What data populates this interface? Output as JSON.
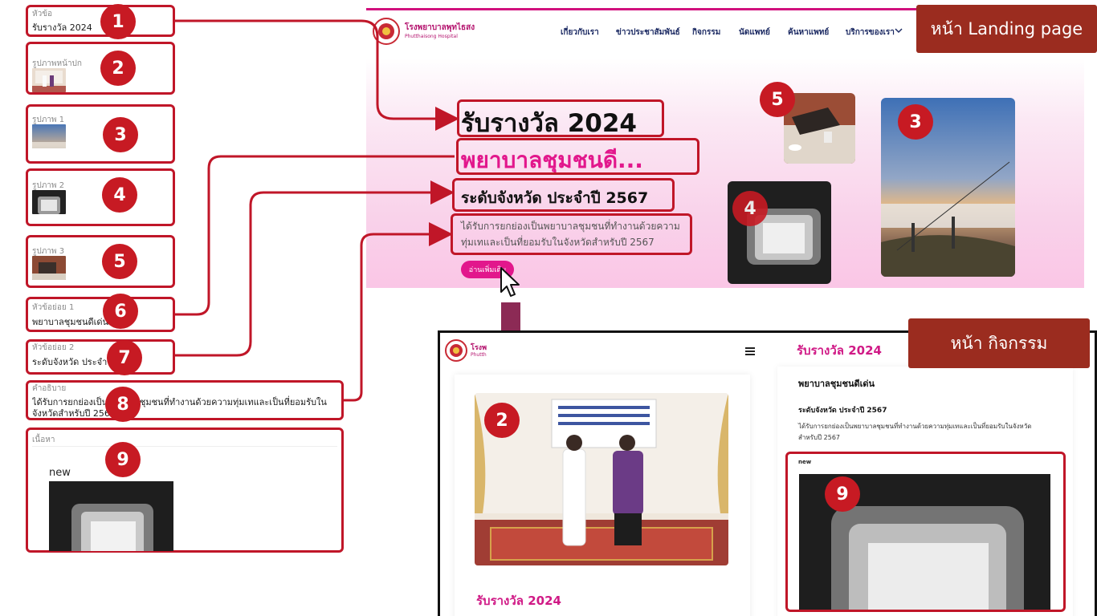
{
  "cms": {
    "fields": [
      {
        "label": "หัวข้อ",
        "value": "รับรางวัล 2024",
        "badge": "1"
      },
      {
        "label": "รูปภาพหน้าปก",
        "badge": "2"
      },
      {
        "label": "รูปภาพ 1",
        "badge": "3"
      },
      {
        "label": "รูปภาพ 2",
        "badge": "4"
      },
      {
        "label": "รูปภาพ 3",
        "badge": "5"
      },
      {
        "label": "หัวข้อย่อย 1",
        "value": "พยาบาลชุมชนดีเด่น",
        "badge": "6"
      },
      {
        "label": "หัวข้อย่อย 2",
        "value": "ระดับจังหวัด ประจำปี",
        "badge": "7"
      },
      {
        "label": "คำอธิบาย",
        "value_line1": "ได้รับการยกย่องเป็นพยาบาลชุมชนที่ทำงานด้วยความทุ่มเทและเป็นที่ยอมรับใน",
        "value_line2": "จังหวัดสำหรับปี 2567",
        "badge": "8"
      },
      {
        "label": "เนื้อหา",
        "content_text": "new",
        "badge": "9"
      }
    ]
  },
  "landing": {
    "tag": "หน้า Landing page",
    "logo_name": "โรงพยาบาลพุทไธสง",
    "logo_sub": "Phutthaisong Hospital",
    "nav": [
      "เกี่ยวกับเรา",
      "ข่าวประชาสัมพันธ์",
      "กิจกรรม",
      "นัดแพทย์",
      "ค้นหาแพทย์",
      "บริการของเรา"
    ],
    "title": "รับรางวัล 2024",
    "subtitle1": "พยาบาลชุมชนดี...",
    "subtitle2": "ระดับจังหวัด ประจำปี 2567",
    "desc_line1": "ได้รับการยกย่องเป็นพยาบาลชุมชนที่ทำงานด้วยความ",
    "desc_line2": "ทุ่มเทและเป็นที่ยอมรับในจังหวัดสำหรับปี 2567",
    "readmore": "อ่านเพิ่มเติม",
    "badges": {
      "img3": "3",
      "img4": "4",
      "img5": "5"
    }
  },
  "activity": {
    "tag": "หน้า กิจกรรม",
    "logo_name": "โรงพ",
    "logo_sub": "Phutth",
    "title_top": "รับรางวัล 2024",
    "title_bottom": "รับรางวัล 2024",
    "heading": "พยาบาลชุมชนดีเด่น",
    "subheading": "ระดับจังหวัด ประจำปี 2567",
    "desc_line1": "ได้รับการยกย่องเป็นพยาบาลชุมชนที่ทำงานด้วยความทุ่มเทและเป็นที่ยอมรับในจังหวัด",
    "desc_line2": "สำหรับปี 2567",
    "content_text": "new",
    "badges": {
      "cover": "2",
      "content": "9"
    }
  },
  "colors": {
    "accent_red": "#c01628",
    "badge_red": "#c71a23",
    "brand_pink": "#e2178c",
    "tag_brown": "#9b2c1f",
    "arrow_purple": "#8c2a55",
    "nav_navy": "#1c2a63"
  },
  "icons": [
    "hospital-logo",
    "chevron-down-icon",
    "mouse-cursor-icon",
    "hamburger-menu-icon",
    "down-arrow-icon"
  ]
}
